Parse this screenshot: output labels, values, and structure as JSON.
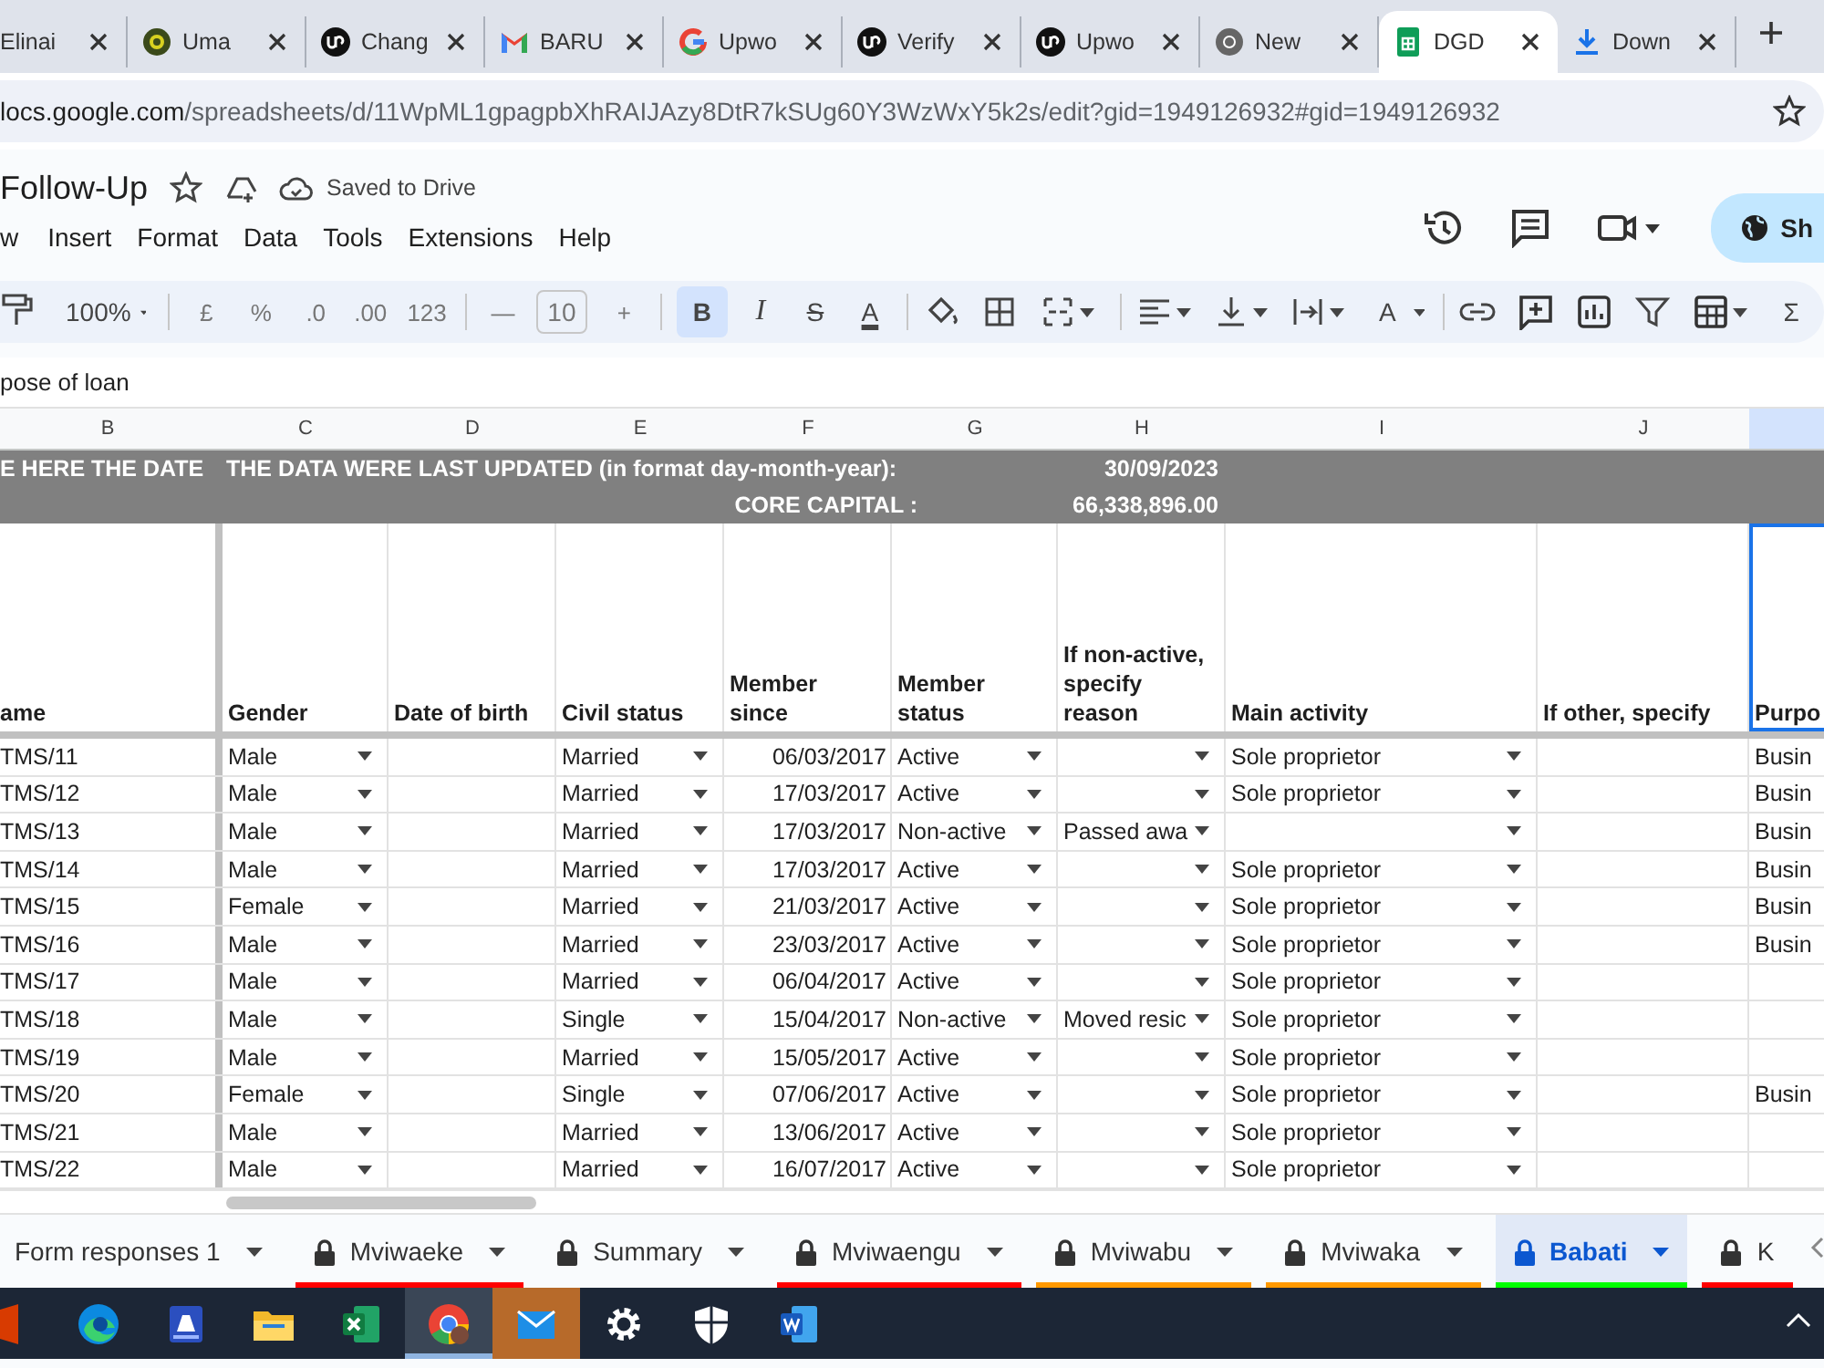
{
  "browser_tabs": [
    {
      "title": "Elinai",
      "kind": "none",
      "selected": false
    },
    {
      "title": "Uma",
      "kind": "ring",
      "selected": false
    },
    {
      "title": "Chang",
      "kind": "upwork",
      "selected": false
    },
    {
      "title": "BARU",
      "kind": "gmail",
      "selected": false
    },
    {
      "title": "Upwo",
      "kind": "google",
      "selected": false
    },
    {
      "title": "Verify",
      "kind": "upwork",
      "selected": false
    },
    {
      "title": "Upwo",
      "kind": "upwork",
      "selected": false
    },
    {
      "title": "New",
      "kind": "chrome",
      "selected": false
    },
    {
      "title": "DGD",
      "kind": "sheets",
      "selected": true
    },
    {
      "title": "Down",
      "kind": "download",
      "selected": false
    }
  ],
  "address_bar": {
    "host": "locs.google.com",
    "path": "/spreadsheets/d/11WpML1gpagpbXhRAIJAzy8DtR7kSUg60Y3WzWxY5k2s/edit?gid=1949126932#gid=1949126932"
  },
  "document": {
    "title": "Follow-Up",
    "save_status": "Saved to Drive",
    "share_label": "Sh"
  },
  "menu": [
    "w",
    "Insert",
    "Format",
    "Data",
    "Tools",
    "Extensions",
    "Help"
  ],
  "toolbar": {
    "zoom": "100%",
    "number_formats": [
      "£",
      "%",
      ".0",
      ".00",
      "123"
    ],
    "font_size_minus": "—",
    "font_size": "10",
    "font_size_plus": "+",
    "styles": [
      {
        "label": "B",
        "selected": true
      },
      {
        "label": "I",
        "selected": false
      },
      {
        "label": "S",
        "selected": false
      },
      {
        "label": "A",
        "selected": false
      }
    ],
    "rotate_label": "A",
    "functions_label": "Σ"
  },
  "formula_bar": "pose of loan",
  "columns": [
    {
      "letter": "B",
      "selected": false
    },
    {
      "letter": "C",
      "selected": false
    },
    {
      "letter": "D",
      "selected": false
    },
    {
      "letter": "E",
      "selected": false
    },
    {
      "letter": "F",
      "selected": false
    },
    {
      "letter": "G",
      "selected": false
    },
    {
      "letter": "H",
      "selected": false
    },
    {
      "letter": "I",
      "selected": false
    },
    {
      "letter": "J",
      "selected": false
    },
    {
      "selected": true
    }
  ],
  "banner": {
    "b_text": "E HERE THE DATE",
    "updated_label": "THE DATA WERE LAST UPDATED (in format day-month-year):",
    "updated_value": "30/09/2023",
    "capital_label": "CORE CAPITAL :",
    "capital_value": "66,338,896.00"
  },
  "headers": [
    "ame",
    "Gender",
    "Date of birth",
    "Civil status",
    "Member\nsince",
    "Member\nstatus",
    "If non-active,\nspecify\nreason",
    "Main activity",
    "If other, specify",
    "Purpo"
  ],
  "rows": [
    {
      "id": "TMS/11",
      "gender": "Male",
      "civil": "Married",
      "since": "06/03/2017",
      "status": "Active",
      "activity": "Sole proprietor",
      "purpose": "Busin"
    },
    {
      "id": "TMS/12",
      "gender": "Male",
      "civil": "Married",
      "since": "17/03/2017",
      "status": "Active",
      "activity": "Sole proprietor",
      "purpose": "Busin"
    },
    {
      "id": "TMS/13",
      "gender": "Male",
      "civil": "Married",
      "since": "17/03/2017",
      "status": "Non-active",
      "reason": "Passed awa",
      "purpose": "Busin"
    },
    {
      "id": "TMS/14",
      "gender": "Male",
      "civil": "Married",
      "since": "17/03/2017",
      "status": "Active",
      "activity": "Sole proprietor",
      "purpose": "Busin"
    },
    {
      "id": "TMS/15",
      "gender": "Female",
      "civil": "Married",
      "since": "21/03/2017",
      "status": "Active",
      "activity": "Sole proprietor",
      "purpose": "Busin"
    },
    {
      "id": "TMS/16",
      "gender": "Male",
      "civil": "Married",
      "since": "23/03/2017",
      "status": "Active",
      "activity": "Sole proprietor",
      "purpose": "Busin"
    },
    {
      "id": "TMS/17",
      "gender": "Male",
      "civil": "Married",
      "since": "06/04/2017",
      "status": "Active",
      "activity": "Sole proprietor"
    },
    {
      "id": "TMS/18",
      "gender": "Male",
      "civil": "Single",
      "since": "15/04/2017",
      "status": "Non-active",
      "reason": "Moved resic",
      "activity": "Sole proprietor"
    },
    {
      "id": "TMS/19",
      "gender": "Male",
      "civil": "Married",
      "since": "15/05/2017",
      "status": "Active",
      "activity": "Sole proprietor"
    },
    {
      "id": "TMS/20",
      "gender": "Female",
      "civil": "Single",
      "since": "07/06/2017",
      "status": "Active",
      "activity": "Sole proprietor",
      "purpose": "Busin"
    },
    {
      "id": "TMS/21",
      "gender": "Male",
      "civil": "Married",
      "since": "13/06/2017",
      "status": "Active",
      "activity": "Sole proprietor"
    },
    {
      "id": "TMS/22",
      "gender": "Male",
      "civil": "Married",
      "since": "16/07/2017",
      "status": "Active",
      "activity": "Sole proprietor"
    }
  ],
  "sheet_tabs": [
    {
      "name": "Form responses 1",
      "locked": false,
      "selected": false
    },
    {
      "name": "Mviwaeke",
      "locked": true,
      "selected": false,
      "color": "#ff0000"
    },
    {
      "name": "Summary",
      "locked": true,
      "selected": false
    },
    {
      "name": "Mviwaengu",
      "locked": true,
      "selected": false,
      "color": "#ff0000"
    },
    {
      "name": "Mviwabu",
      "locked": true,
      "selected": false,
      "color": "#ff9900"
    },
    {
      "name": "Mviwaka",
      "locked": true,
      "selected": false,
      "color": "#ff9900"
    },
    {
      "name": "Babati",
      "locked": true,
      "selected": true,
      "color": "#00ff00"
    },
    {
      "name": "K",
      "locked": true,
      "selected": false,
      "color": "#ff0000"
    }
  ],
  "taskbar": [
    {
      "kind": "office",
      "selected": false,
      "flashing": false
    },
    {
      "kind": "edge",
      "selected": false,
      "flashing": false
    },
    {
      "kind": "scanner",
      "selected": false,
      "flashing": false
    },
    {
      "kind": "files",
      "selected": false,
      "flashing": false
    },
    {
      "kind": "excel",
      "selected": false,
      "flashing": false
    },
    {
      "kind": "chrome",
      "selected": true,
      "flashing": false
    },
    {
      "kind": "mail",
      "selected": false,
      "flashing": true
    },
    {
      "kind": "settings",
      "selected": false,
      "flashing": false
    },
    {
      "kind": "shield",
      "selected": false,
      "flashing": false
    },
    {
      "kind": "word",
      "selected": false,
      "flashing": false
    }
  ]
}
